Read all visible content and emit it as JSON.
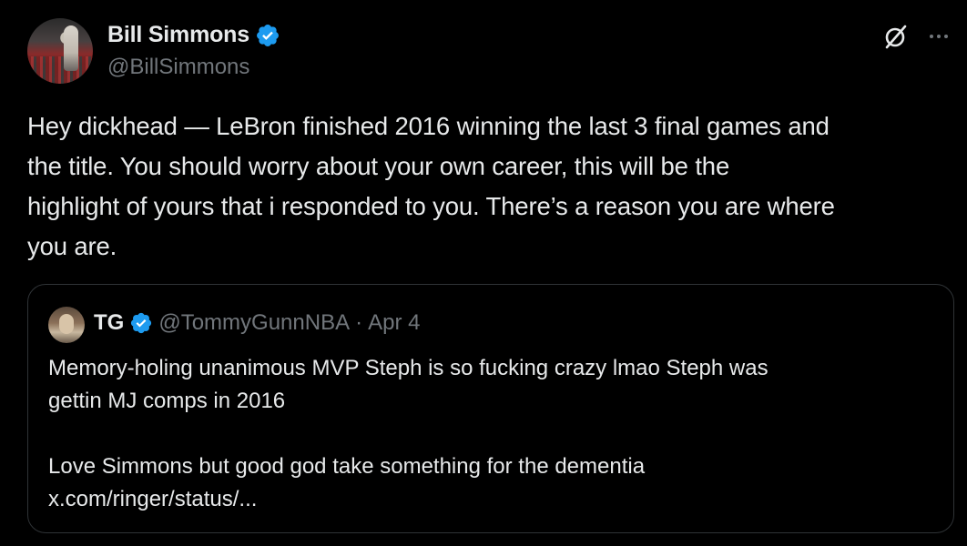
{
  "tweet": {
    "display_name": "Bill Simmons",
    "handle": "@BillSimmons",
    "text": "Hey dickhead — LeBron finished 2016 winning the last 3 final games and\nthe title. You should worry about your own career, this will be the\nhighlight of yours that i responded to you. There’s a reason you are where\nyou are.",
    "verified_color": "#1d9bf0"
  },
  "icons": {
    "avatar": "avatar-photo",
    "verified": "verified-badge-icon",
    "grok": "grok-icon",
    "more": "more-options-icon"
  },
  "quoted_tweet": {
    "display_name": "TG",
    "handle": "@TommyGunnNBA",
    "separator": "·",
    "date": "Apr 4",
    "text": "Memory-holing unanimous MVP Steph is so fucking crazy lmao Steph was\ngettin MJ comps in 2016\n\nLove Simmons but good god take something for the dementia\nx.com/ringer/status/..."
  },
  "colors": {
    "background": "#000000",
    "text": "#e7e9ea",
    "secondary_text": "#71767b",
    "border": "#2f3336"
  }
}
